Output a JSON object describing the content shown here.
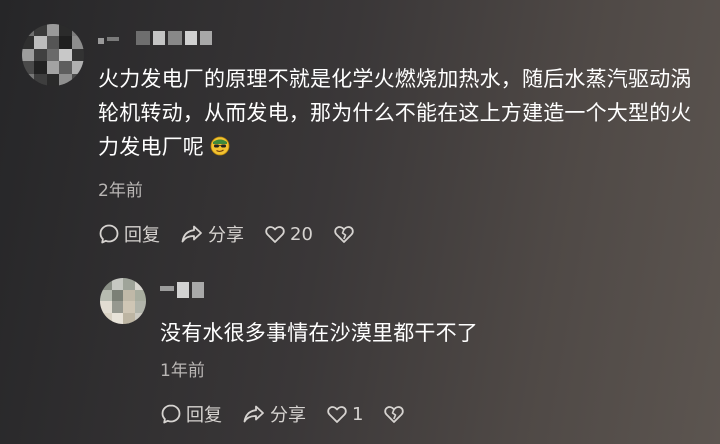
{
  "comment": {
    "text": "火力发电厂的原理不就是化学火燃烧加热水，随后水蒸汽驱动涡轮机转动，从而发电，那为什么不能在这上方建造一个大型的火力发电厂呢",
    "emoji_icon": "sunglasses-face-icon",
    "timestamp": "2年前",
    "actions": {
      "reply_label": "回复",
      "share_label": "分享",
      "like_count": "20"
    }
  },
  "reply": {
    "text": "没有水很多事情在沙漠里都干不了",
    "timestamp": "1年前",
    "actions": {
      "reply_label": "回复",
      "share_label": "分享",
      "like_count": "1"
    }
  },
  "colors": {
    "text": "#ffffff",
    "secondary_text": "#b9b6b4",
    "action_text": "#d6d3d0"
  }
}
